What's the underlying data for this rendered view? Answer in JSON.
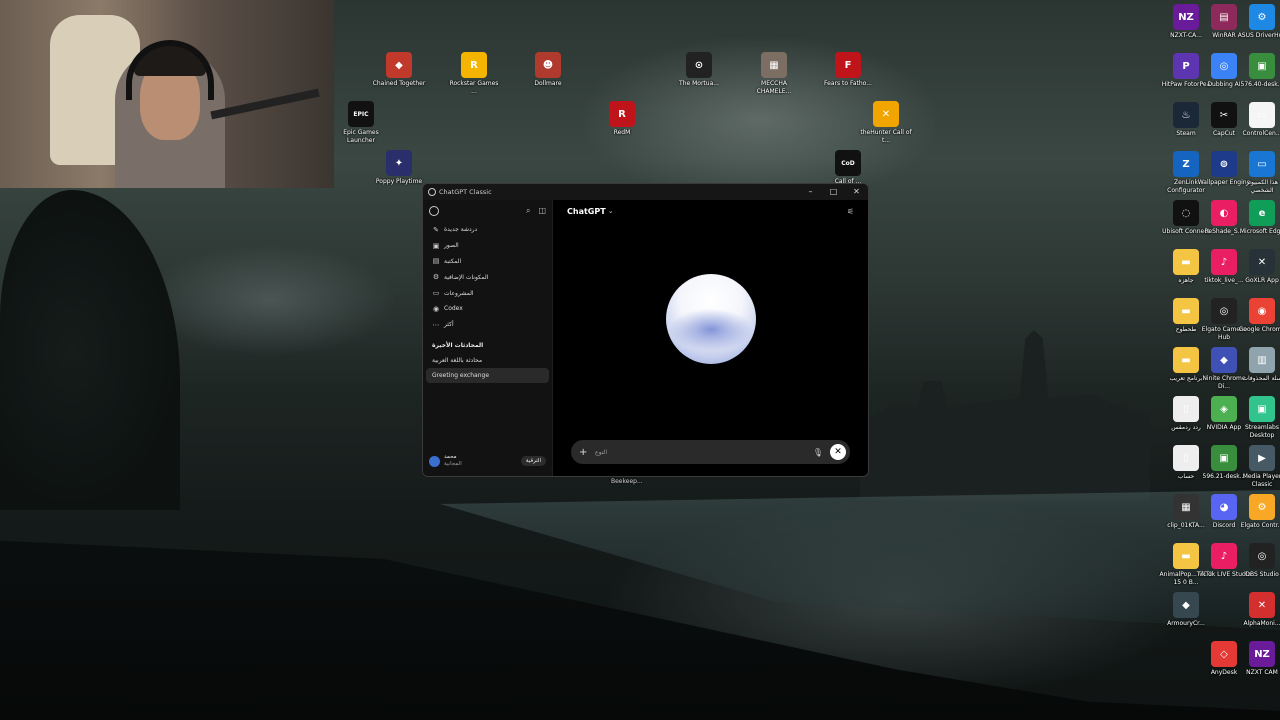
{
  "window": {
    "title": "ChatGPT Classic",
    "controls": [
      "–",
      "□",
      "✕"
    ]
  },
  "sidebar": {
    "items": [
      {
        "icon": "new-chat-icon",
        "glyph": "✎",
        "label": "دردشة جديدة"
      },
      {
        "icon": "images-icon",
        "glyph": "▣",
        "label": "الصور"
      },
      {
        "icon": "library-icon",
        "glyph": "▤",
        "label": "المكتبة"
      },
      {
        "icon": "apps-icon",
        "glyph": "⚙",
        "label": "المكونات الإضافية"
      },
      {
        "icon": "projects-icon",
        "glyph": "▭",
        "label": "المشروعات"
      },
      {
        "icon": "codex-icon",
        "glyph": "◉",
        "label": "Codex"
      },
      {
        "icon": "more-icon",
        "glyph": "⋯",
        "label": "أكثر"
      }
    ],
    "recent_heading": "المحادثات الأخيرة",
    "chats": [
      {
        "label": "محادثة باللغة العربية",
        "active": false
      },
      {
        "label": "Greeting exchange",
        "active": true
      }
    ],
    "user": {
      "name": "محمد",
      "plan": "المجانية",
      "upgrade": "الترقية"
    }
  },
  "main": {
    "model": "ChatGPT",
    "composer_placeholder": "التوع"
  },
  "taskbar_tooltip": "Beekeep...",
  "desktop_icons": [
    {
      "label": "Chained Together",
      "color": "#c0392b",
      "glyph": "◆"
    },
    {
      "label": "Rockstar Games ...",
      "color": "#f4b400",
      "glyph": "R"
    },
    {
      "label": "Dollmare",
      "color": "#b03a2e",
      "glyph": "☻"
    },
    {
      "label": "The Mortua...",
      "color": "#222222",
      "glyph": "⊙"
    },
    {
      "label": "MECCHA CHAMELE...",
      "color": "#7d6e64",
      "glyph": "▦"
    },
    {
      "label": "Fears to Fatho...",
      "color": "#c0141b",
      "glyph": "F"
    },
    {
      "label": "Epic Games Launcher",
      "color": "#111111",
      "glyph": "EPIC"
    },
    {
      "label": "RedM",
      "color": "#c0141b",
      "glyph": "R"
    },
    {
      "label": "theHunter Call of t...",
      "color": "#f0a500",
      "glyph": "✕"
    },
    {
      "label": "Poppy Playtime",
      "color": "#2a2f6b",
      "glyph": "✦"
    },
    {
      "label": "Call of ...",
      "color": "#111111",
      "glyph": "CoD"
    },
    {
      "label": "NZXT-CA...",
      "color": "#6a1b9a",
      "glyph": "NZ"
    },
    {
      "label": "WinRAR",
      "color": "#8e2a5b",
      "glyph": "▤"
    },
    {
      "label": "ASUS DriverHub",
      "color": "#1e88e5",
      "glyph": "⚙"
    },
    {
      "label": "HitPaw FotorPea",
      "color": "#5e35b1",
      "glyph": "P"
    },
    {
      "label": "Dubbing AI",
      "color": "#3b82f6",
      "glyph": "◎"
    },
    {
      "label": "576.40-desk...",
      "color": "#388e3c",
      "glyph": "▣"
    },
    {
      "label": "Steam",
      "color": "#1b2838",
      "glyph": "♨"
    },
    {
      "label": "CapCut",
      "color": "#111111",
      "glyph": "✂"
    },
    {
      "label": "ControlCen...",
      "color": "#f5f5f5",
      "glyph": "▭"
    },
    {
      "label": "ZenLink Configurator",
      "color": "#1565c0",
      "glyph": "Z"
    },
    {
      "label": "Wallpaper Engine",
      "color": "#1e3a8a",
      "glyph": "⊚"
    },
    {
      "label": "هذا الكمبيوتر الشخصي",
      "color": "#1976d2",
      "glyph": "▭"
    },
    {
      "label": "Ubisoft Connect",
      "color": "#111111",
      "glyph": "◌"
    },
    {
      "label": "ReShade_S...",
      "color": "#e91e63",
      "glyph": "◐"
    },
    {
      "label": "Microsoft Edge",
      "color": "#0f9d58",
      "glyph": "e"
    },
    {
      "label": "جاهزه",
      "color": "#f4c542",
      "glyph": "▬"
    },
    {
      "label": "tiktok_live_...",
      "color": "#e91e63",
      "glyph": "♪"
    },
    {
      "label": "GoXLR App",
      "color": "#263238",
      "glyph": "✕"
    },
    {
      "label": "طحطوح",
      "color": "#f4c542",
      "glyph": "▬"
    },
    {
      "label": "Elgato Camera Hub",
      "color": "#222222",
      "glyph": "◎"
    },
    {
      "label": "Google Chrome",
      "color": "#ea4335",
      "glyph": "◉"
    },
    {
      "label": "برنامج تعريب",
      "color": "#f4c542",
      "glyph": "▬"
    },
    {
      "label": "Ninite Chrome Di...",
      "color": "#3f51b5",
      "glyph": "◆"
    },
    {
      "label": "سلة المحذوفات",
      "color": "#90a4ae",
      "glyph": "▥"
    },
    {
      "label": "ردد ردمقس",
      "color": "#eeeeee",
      "glyph": "▯"
    },
    {
      "label": "NVIDIA App",
      "color": "#4caf50",
      "glyph": "◈"
    },
    {
      "label": "Streamlabs Desktop",
      "color": "#31c48d",
      "glyph": "▣"
    },
    {
      "label": "حساب",
      "color": "#eeeeee",
      "glyph": "▯"
    },
    {
      "label": "596.21-desk...",
      "color": "#388e3c",
      "glyph": "▣"
    },
    {
      "label": "Media Player Classic",
      "color": "#455a64",
      "glyph": "▶"
    },
    {
      "label": "clip_01KTA...",
      "color": "#333333",
      "glyph": "▦"
    },
    {
      "label": "Discord",
      "color": "#5865f2",
      "glyph": "◕"
    },
    {
      "label": "Elgato Contr...",
      "color": "#f9a825",
      "glyph": "⚙"
    },
    {
      "label": "AnimalPop... V1 2 15 0 B...",
      "color": "#f4c542",
      "glyph": "▬"
    },
    {
      "label": "TikTok LIVE Studio",
      "color": "#e91e63",
      "glyph": "♪"
    },
    {
      "label": "OBS Studio",
      "color": "#222222",
      "glyph": "◎"
    },
    {
      "label": "ArmouryCr...",
      "color": "#37474f",
      "glyph": "◆"
    },
    {
      "label": "AlphaMoni...",
      "color": "#d32f2f",
      "glyph": "✕"
    },
    {
      "label": "AnyDesk",
      "color": "#e53935",
      "glyph": "◇"
    },
    {
      "label": "NZXT CAM",
      "color": "#6a1b9a",
      "glyph": "NZ"
    }
  ]
}
